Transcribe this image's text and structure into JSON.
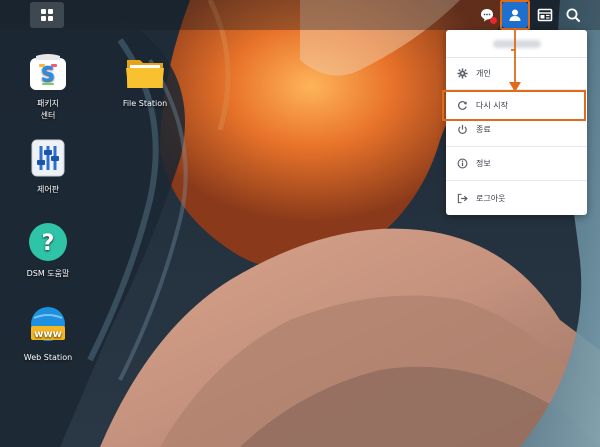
{
  "taskbar": {
    "main_menu_icon": "grid-icon",
    "tray": [
      {
        "name": "notification-icon",
        "badge_color": "#e8262b"
      },
      {
        "name": "user-icon",
        "active": true
      },
      {
        "name": "widgets-icon"
      },
      {
        "name": "search-icon"
      }
    ],
    "accent_color": "#1f6fcf"
  },
  "desktop": {
    "icons": [
      {
        "label": "패키지\n센터",
        "icon": "package-center-icon"
      },
      {
        "label": "File Station",
        "icon": "folder-icon"
      },
      {
        "label": "제어판",
        "icon": "control-panel-icon"
      },
      {
        "label": "DSM 도움말",
        "icon": "help-icon"
      },
      {
        "label": "Web Station",
        "icon": "web-station-icon"
      }
    ]
  },
  "user_menu": {
    "username_blurred": true,
    "items": [
      {
        "label": "개인",
        "icon": "gear-icon"
      },
      {
        "label": "다시 시작",
        "icon": "restart-icon",
        "highlighted": true
      },
      {
        "label": "종료",
        "icon": "power-icon"
      },
      {
        "label": "정보",
        "icon": "info-icon"
      },
      {
        "label": "로그아웃",
        "icon": "logout-icon"
      }
    ]
  },
  "annotation": {
    "highlight_color": "#e06b1b"
  }
}
